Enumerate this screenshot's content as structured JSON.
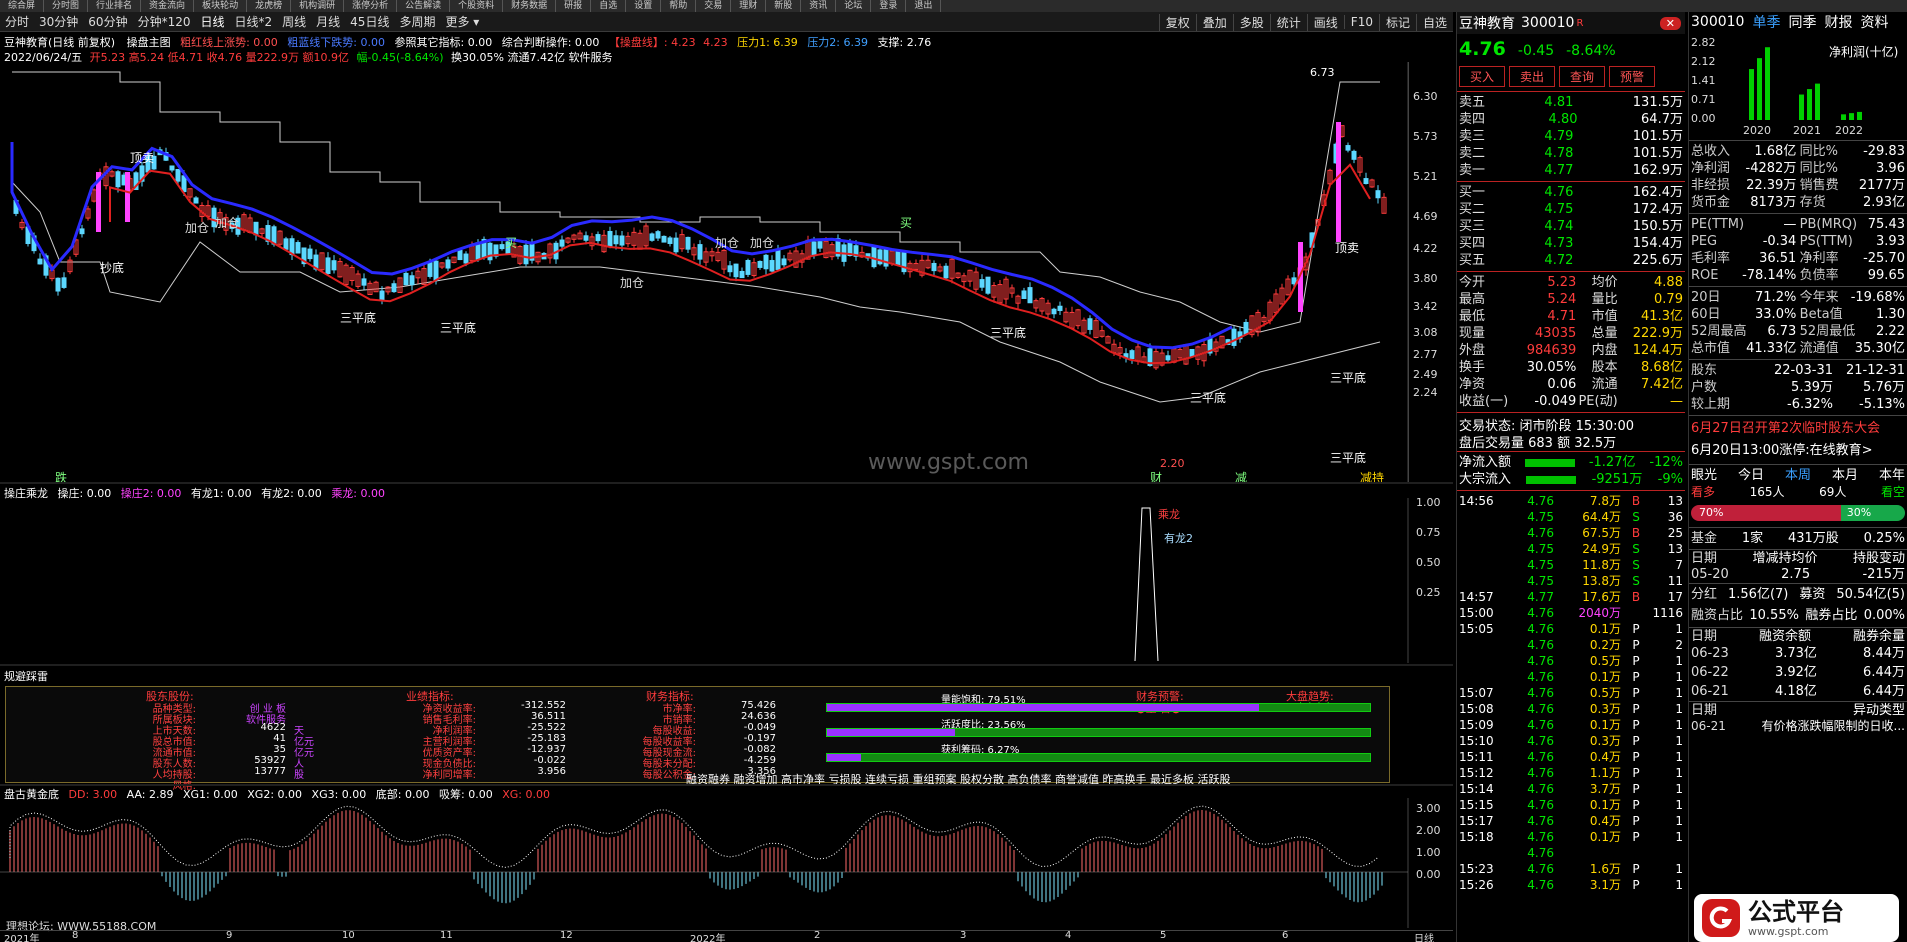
{
  "colors": {
    "up": "#ff3c3c",
    "down": "#00e600",
    "ma_blue": "#2a2aff",
    "ma_red": "#e02020",
    "band": "#dcdcdc"
  },
  "topbar": [
    "综合屏",
    "分时图",
    "行业排名",
    "资金流向",
    "板块轮动",
    "龙虎榜",
    "机构调研",
    "涨停分析",
    "公告解读",
    "个股资料",
    "财务数据",
    "研报",
    "自选",
    "设置",
    "帮助",
    "交易",
    "理财",
    "新股",
    "资讯",
    "论坛",
    "登录",
    "退出"
  ],
  "periods": [
    "分时",
    "30分钟",
    "60分钟",
    "分钟*120",
    "日线",
    "日线*2",
    "周线",
    "月线",
    "45日线",
    "多周期",
    "更多 ▾"
  ],
  "period_tools": [
    "复权",
    "叠加",
    "多股",
    "统计",
    "画线",
    "F10",
    "标记",
    "自选"
  ],
  "main": {
    "title": "豆神教育(日线 前复权)",
    "indicator": "操盘主图",
    "ind_a": "粗红线上涨势: 0.00",
    "ind_b": "粗蓝线下跌势: 0.00",
    "ind_c": "参照其它指标: 0.00",
    "ind_d": "综合判断操作: 0.00",
    "ind_e": "【操盘线】: 4.23",
    "ind_f": "4.23",
    "ind_g": "压力1: 6.39",
    "ind_h": "压力2: 6.39",
    "ind_i": "支撑: 2.76",
    "date": "2022/06/24/五",
    "ohlc": "开5.23 高5.24 低4.71 收4.76 量222.9万 额10.9亿",
    "change": "幅-0.45(-8.64%)",
    "extra": "换30.05% 流通7.42亿 软件服务",
    "watermark": "www.gspt.com",
    "y_ticks": [
      "6.30",
      "5.73",
      "5.21",
      "4.69",
      "4.22",
      "3.80",
      "3.42",
      "3.08",
      "2.77",
      "2.49",
      "2.24"
    ],
    "high_label": "6.73",
    "low_label": "2.20",
    "annotations": [
      "顶卖",
      "抄底",
      "三平底",
      "三平底",
      "加仓",
      "加仓",
      "加仓",
      "加仓",
      "加仓",
      "买",
      "买",
      "三平底",
      "三平底",
      "三平底",
      "顶卖",
      "三平底",
      "跌",
      "财",
      "减",
      "减持"
    ]
  },
  "sub1": {
    "title": "操庄乘龙",
    "a": "操庄: 0.00",
    "b": "操庄2: 0.00",
    "c": "有龙1: 0.00",
    "d": "有龙2: 0.00",
    "e": "乘龙: 0.00",
    "y_ticks": [
      "1.00",
      "0.75",
      "0.50",
      "0.25"
    ],
    "label1": "乘龙",
    "label2": "有龙2"
  },
  "panel": {
    "title": "规避踩雷",
    "h1": "股东股份:",
    "h2": "业绩指标:",
    "h3": "财务指标:",
    "h4": "财务预警:",
    "h5": "大盘趋势:",
    "warn": "●重 警●",
    "trend": "↓↓↓↓",
    "col1": [
      [
        "品种类型:",
        "创 业 板",
        ""
      ],
      [
        "所属板块:",
        "软件服务",
        ""
      ],
      [
        "上市天数:",
        "4622",
        "天"
      ],
      [
        "股总市值:",
        "41",
        "亿元"
      ],
      [
        "流通市值:",
        "35",
        "亿元"
      ],
      [
        "股东人数:",
        "53927",
        "人"
      ],
      [
        "人均持股:",
        "13777",
        "股"
      ],
      [
        "风格:",
        "",
        ""
      ]
    ],
    "col2": [
      [
        "净资收益率:",
        "-312.552"
      ],
      [
        "销售毛利率:",
        "36.511"
      ],
      [
        "净利润率:",
        "-25.522"
      ],
      [
        "主营利润率:",
        "-25.183"
      ],
      [
        "优质资产率:",
        "-12.937"
      ],
      [
        "现金负债比:",
        "-0.022"
      ],
      [
        "净利同增率:",
        "3.956"
      ]
    ],
    "col3": [
      [
        "市净率:",
        "75.426"
      ],
      [
        "市销率:",
        "24.636"
      ],
      [
        "每股收益:",
        "-0.049"
      ],
      [
        "每股收益率:",
        "-0.197"
      ],
      [
        "每股现金流:",
        "-0.082"
      ],
      [
        "每股未分配:",
        "-4.259"
      ],
      [
        "每股公积金:",
        "3.356"
      ]
    ],
    "bar1_label": "量能饱和:",
    "bar1_val": "79.51%",
    "bar1_pct": 79.51,
    "bar2_label": "活跃度比:",
    "bar2_val": "23.56%",
    "bar2_pct": 23.56,
    "bar3_label": "获利筹码:",
    "bar3_val": "6.27%",
    "bar3_pct": 6.27,
    "tags": "融资融券 融资增加 高市净率 亏损股 连续亏损 重组预案 股权分散 高负债率 商誉减值 昨高换手 最近多板 活跃股"
  },
  "sub2": {
    "title": "盘古黄金底",
    "a": "DD: 3.00",
    "b": "AA: 2.89",
    "c": "XG1: 0.00",
    "d": "XG2: 0.00",
    "e": "XG3: 0.00",
    "f": "底部: 0.00",
    "g": "吸筹: 0.00",
    "h": "XG: 0.00",
    "y_ticks": [
      "3.00",
      "2.00",
      "1.00",
      "0.00"
    ],
    "forum": "理想论坛: WWW.55188.COM"
  },
  "x_axis": [
    "2021年",
    "8",
    "9",
    "10",
    "11",
    "12",
    "2022年",
    "2",
    "3",
    "4",
    "5",
    "6"
  ],
  "x_axis_right": "日线",
  "quote": {
    "name": "豆神教育",
    "code": "300010",
    "tag": "R",
    "price": "4.76",
    "chg": "-0.45",
    "pct": "-8.64%",
    "buttons": [
      "买入",
      "卖出",
      "查询",
      "预警"
    ],
    "asks": [
      [
        "卖五",
        "4.81",
        "131.5万"
      ],
      [
        "卖四",
        "4.80",
        "64.7万"
      ],
      [
        "卖三",
        "4.79",
        "101.5万"
      ],
      [
        "卖二",
        "4.78",
        "101.5万"
      ],
      [
        "卖一",
        "4.77",
        "162.9万"
      ]
    ],
    "bids": [
      [
        "买一",
        "4.76",
        "162.4万"
      ],
      [
        "买二",
        "4.75",
        "172.4万"
      ],
      [
        "买三",
        "4.74",
        "150.5万"
      ],
      [
        "买四",
        "4.73",
        "154.4万"
      ],
      [
        "买五",
        "4.72",
        "225.6万"
      ]
    ],
    "stats": [
      [
        "今开",
        "5.23",
        "均价",
        "4.88"
      ],
      [
        "最高",
        "5.24",
        "量比",
        "0.79"
      ],
      [
        "最低",
        "4.71",
        "市值",
        "41.3亿"
      ],
      [
        "现量",
        "43035",
        "总量",
        "222.9万"
      ],
      [
        "外盘",
        "984639",
        "内盘",
        "124.4万"
      ],
      [
        "换手",
        "30.05%",
        "股本",
        "8.68亿"
      ],
      [
        "净资",
        "0.06",
        "流通",
        "7.42亿"
      ],
      [
        "收益(一)",
        "-0.049",
        "PE(动)",
        "—"
      ]
    ],
    "status": "交易状态: 闭市阶段 15:30:00",
    "after": "盘后交易量 683 额 32.5万",
    "flow1": [
      "净流入额",
      "-1.27亿",
      "-12%"
    ],
    "flow2": [
      "大宗流入",
      "-9251万",
      "-9%"
    ],
    "ticks": [
      [
        "14:56",
        "4.76",
        "7.8万",
        "B",
        "13"
      ],
      [
        "",
        "4.75",
        "64.4万",
        "S",
        "36"
      ],
      [
        "",
        "4.76",
        "67.5万",
        "B",
        "25"
      ],
      [
        "",
        "4.75",
        "24.9万",
        "S",
        "13"
      ],
      [
        "",
        "4.75",
        "11.8万",
        "S",
        "7"
      ],
      [
        "",
        "4.75",
        "13.8万",
        "S",
        "11"
      ],
      [
        "14:57",
        "4.77",
        "17.6万",
        "B",
        "17"
      ],
      [
        "15:00",
        "4.76",
        "2040万",
        "",
        "1116"
      ],
      [
        "15:05",
        "4.76",
        "0.1万",
        "P",
        "1"
      ],
      [
        "",
        "4.76",
        "0.2万",
        "P",
        "2"
      ],
      [
        "",
        "4.76",
        "0.5万",
        "P",
        "1"
      ],
      [
        "",
        "4.76",
        "0.1万",
        "P",
        "1"
      ],
      [
        "15:07",
        "4.76",
        "0.5万",
        "P",
        "1"
      ],
      [
        "15:08",
        "4.76",
        "0.3万",
        "P",
        "1"
      ],
      [
        "15:09",
        "4.76",
        "0.1万",
        "P",
        "1"
      ],
      [
        "15:10",
        "4.76",
        "0.3万",
        "P",
        "1"
      ],
      [
        "15:11",
        "4.76",
        "0.4万",
        "P",
        "1"
      ],
      [
        "15:12",
        "4.76",
        "1.1万",
        "P",
        "1"
      ],
      [
        "15:14",
        "4.76",
        "3.7万",
        "P",
        "1"
      ],
      [
        "15:15",
        "4.76",
        "0.1万",
        "P",
        "1"
      ],
      [
        "15:17",
        "4.76",
        "0.4万",
        "P",
        "1"
      ],
      [
        "15:18",
        "4.76",
        "0.1万",
        "P",
        "1"
      ],
      [
        "",
        "4.76",
        "",
        "",
        " "
      ],
      [
        "15:23",
        "4.76",
        "1.6万",
        "P",
        "1"
      ],
      [
        "15:26",
        "4.76",
        "3.1万",
        "P",
        "1"
      ]
    ]
  },
  "f10": {
    "code": "300010",
    "tabs": [
      "单季",
      "同季",
      "财报",
      "资料"
    ],
    "chart_title": "净利润(十亿)",
    "chart_data": {
      "type": "bar",
      "categories": [
        "2020",
        "2021",
        "2022"
      ],
      "y_ticks": [
        "2.82",
        "2.12",
        "1.41",
        "0.71",
        "0.00"
      ],
      "values": [
        2.7,
        1.35,
        0.3
      ]
    },
    "fin": [
      [
        "总收入",
        "1.68亿",
        "同比%",
        "-29.83"
      ],
      [
        "净利润",
        "-4282万",
        "同比%",
        "3.96"
      ],
      [
        "非经损",
        "22.39万",
        "销售费",
        "2177万"
      ],
      [
        "货币金",
        "8173万",
        "存货",
        "2.93亿"
      ]
    ],
    "val": [
      [
        "PE(TTM)",
        "—",
        "PB(MRQ)",
        "75.43"
      ],
      [
        "PEG",
        "-0.34",
        "PS(TTM)",
        "3.93"
      ],
      [
        "毛利率",
        "36.51",
        "净利率",
        "-25.70"
      ],
      [
        "ROE",
        "-78.14%",
        "负债率",
        "99.65"
      ]
    ],
    "perf": [
      [
        "20日",
        "71.2%",
        "今年来",
        "-19.68%"
      ],
      [
        "60日",
        "33.0%",
        "Beta值",
        "1.30"
      ],
      [
        "52周最高",
        "6.73",
        "52周最低",
        "2.22"
      ],
      [
        "总市值",
        "41.33亿",
        "流通值",
        "35.30亿"
      ]
    ],
    "holders": [
      [
        "股东",
        "22-03-31",
        "21-12-31"
      ],
      [
        "户数",
        "5.39万",
        "5.76万"
      ],
      [
        "较上期",
        "-6.32%",
        "-5.13%"
      ]
    ],
    "news1": "6月27日召开第2次临时股东大会",
    "news2": "6月20日13:00涨停:在线教育>",
    "opinion": "眼光",
    "opt": [
      "今日",
      "本周",
      "本月",
      "本年"
    ],
    "bull": "看多",
    "bull_n": "165人",
    "bear_n": "69人",
    "bear": "看空",
    "bull_pct": "70%",
    "bear_pct": "30%",
    "bull_ratio": 0.7,
    "fund": [
      "基金",
      "1家",
      "431万股",
      "0.25%"
    ],
    "hold_hdr": [
      "日期",
      "增减持均价",
      "持股变动"
    ],
    "hold_row": [
      "05-20",
      "2.75",
      "-215万"
    ],
    "div": [
      "分红",
      "1.56亿(7)",
      "募资",
      "50.54亿(5)"
    ],
    "margin": [
      "融资占比",
      "10.55%",
      "融券占比",
      "0.00%"
    ],
    "margin_hdr": [
      "日期",
      "融资余额",
      "融券余量"
    ],
    "margin_rows": [
      [
        "06-23",
        "3.73亿",
        "8.44万"
      ],
      [
        "06-22",
        "3.92亿",
        "6.44万"
      ],
      [
        "06-21",
        "4.18亿",
        "6.44万"
      ]
    ],
    "abn_hdr": [
      "日期",
      "异动类型"
    ],
    "abn_row": [
      "06-21",
      "有价格涨跌幅限制的日收..."
    ]
  },
  "logo": {
    "text": "公式平台",
    "url": "www.gspt.com"
  }
}
